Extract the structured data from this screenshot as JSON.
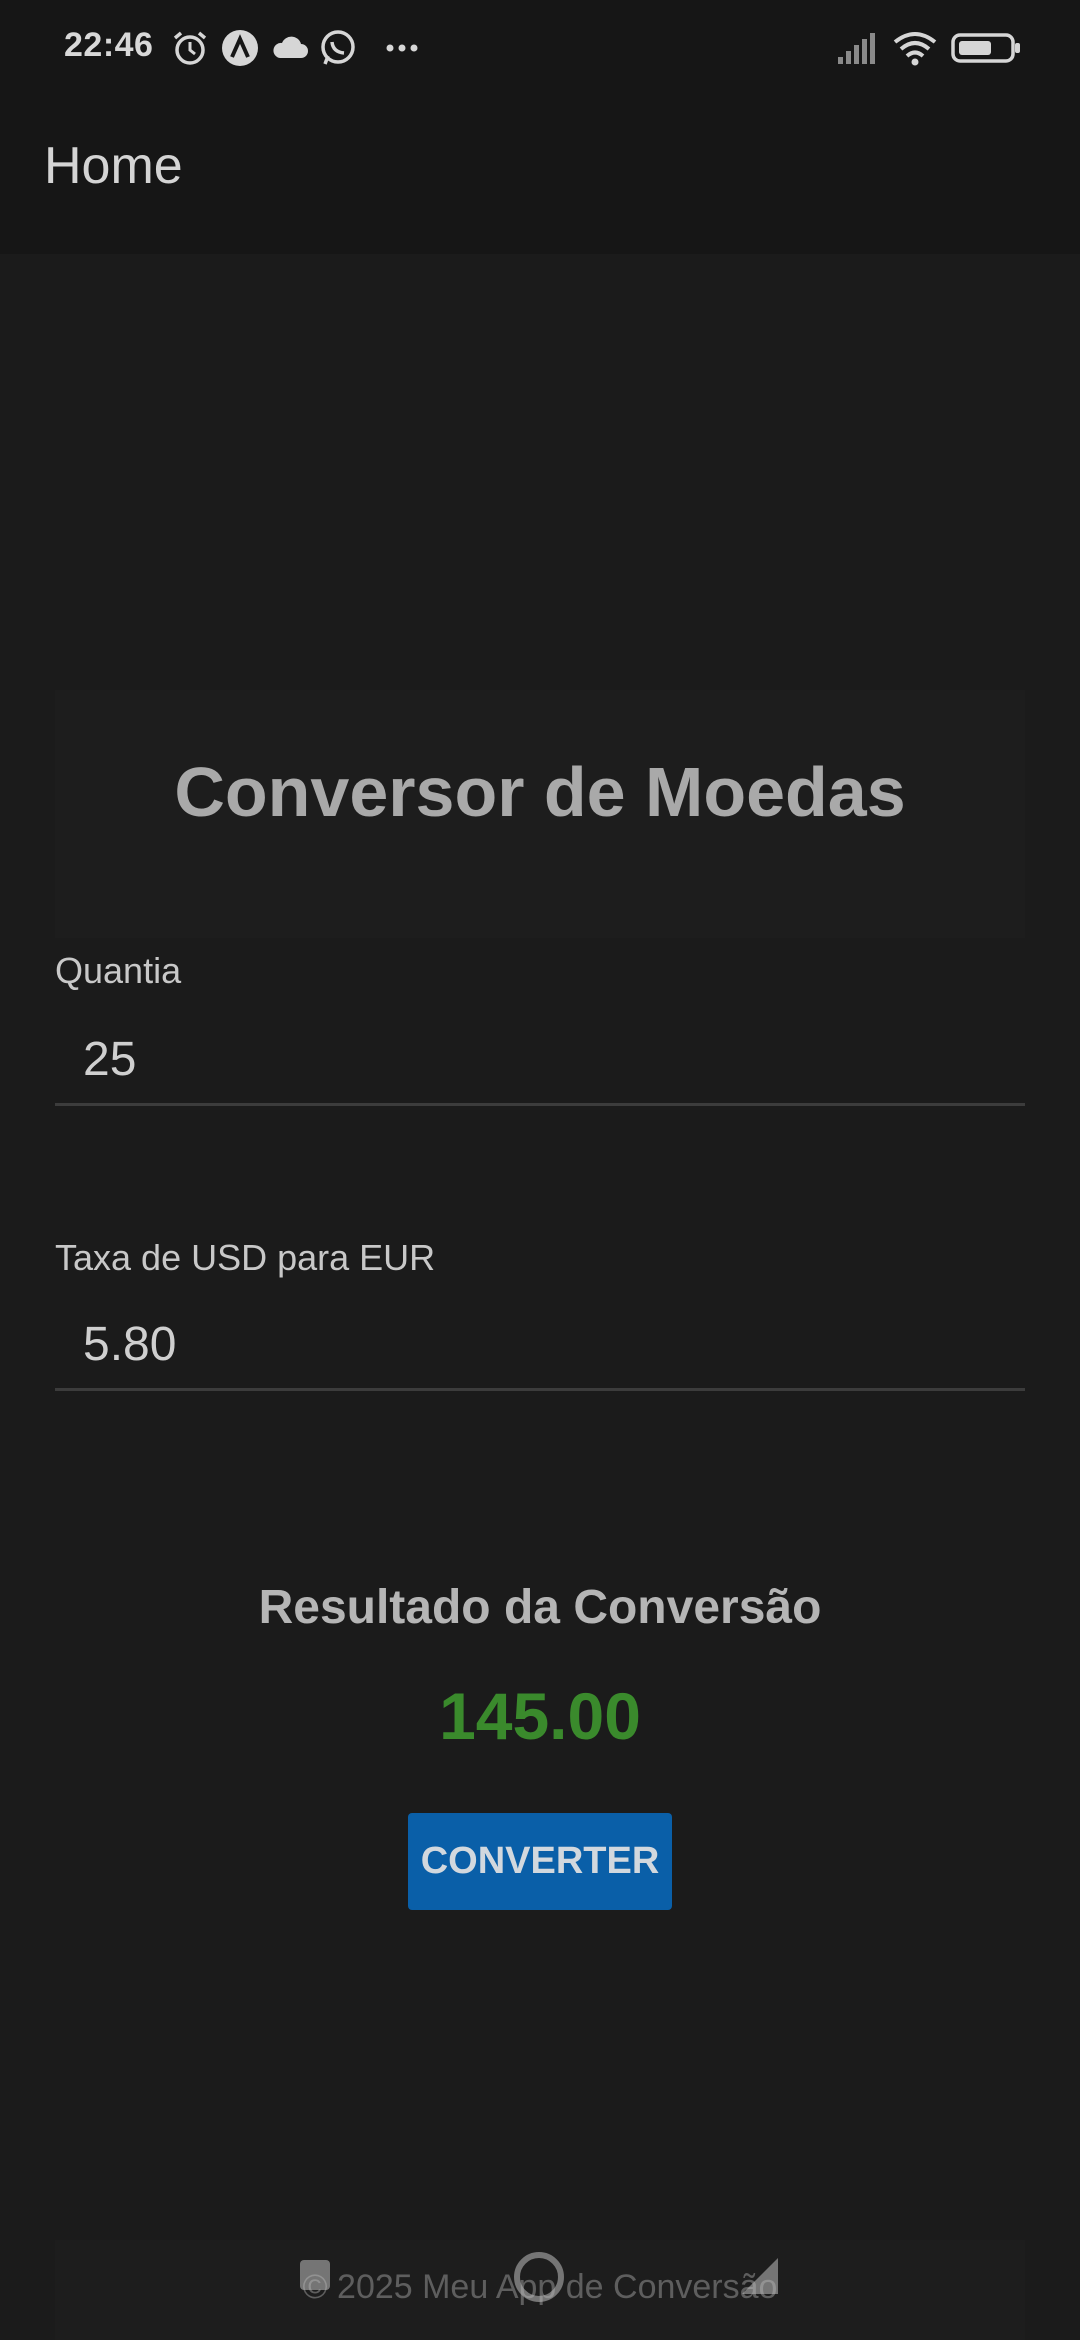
{
  "status_bar": {
    "time": "22:46",
    "icons": [
      "alarm-icon",
      "app-a-icon",
      "cloud-icon",
      "whatsapp-icon",
      "more-icon",
      "signal-icon",
      "wifi-icon",
      "battery-icon"
    ]
  },
  "app_bar": {
    "title": "Home"
  },
  "header": {
    "title": "Conversor de Moedas"
  },
  "form": {
    "amount_label": "Quantia",
    "amount_value": "25",
    "rate_label": "Taxa de USD para EUR",
    "rate_value": "5.80"
  },
  "result": {
    "title": "Resultado da Conversão",
    "value": "145.00",
    "value_color": "#3a8a2c"
  },
  "actions": {
    "convert_label": "CONVERTER",
    "button_color": "#0a5fa8"
  },
  "footer": {
    "text": "© 2025 Meu App de Conversão"
  },
  "nav_bar": {
    "icons": [
      "recents-square-icon",
      "home-circle-icon",
      "back-triangle-icon"
    ]
  }
}
